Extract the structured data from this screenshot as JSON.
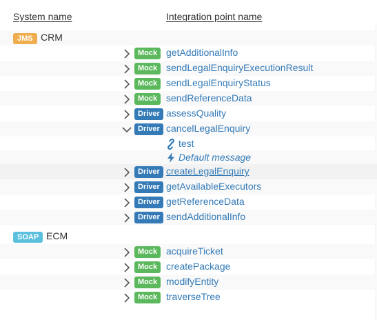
{
  "header": {
    "system_name": "System name",
    "integration_point_name": "Integration point name"
  },
  "systems": [
    {
      "badge": "JMS",
      "badge_color": "#f0ad4e",
      "name": "CRM",
      "points": [
        {
          "type": "Mock",
          "name": "getAdditionalInfo",
          "expanded": false
        },
        {
          "type": "Mock",
          "name": "sendLegalEnquiryExecutionResult",
          "expanded": false
        },
        {
          "type": "Mock",
          "name": "sendLegalEnquiryStatus",
          "expanded": false
        },
        {
          "type": "Mock",
          "name": "sendReferenceData",
          "expanded": false
        },
        {
          "type": "Driver",
          "name": "assessQuality",
          "expanded": false
        },
        {
          "type": "Driver",
          "name": "cancelLegalEnquiry",
          "expanded": true,
          "children": [
            {
              "icon": "link-icon",
              "text": "test",
              "italic": false
            },
            {
              "icon": "lightning-icon",
              "text": "Default message",
              "italic": true
            }
          ]
        },
        {
          "type": "Driver",
          "name": "createLegalEnquiry",
          "expanded": false,
          "hovered": true
        },
        {
          "type": "Driver",
          "name": "getAvailableExecutors",
          "expanded": false
        },
        {
          "type": "Driver",
          "name": "getReferenceData",
          "expanded": false
        },
        {
          "type": "Driver",
          "name": "sendAdditionalInfo",
          "expanded": false
        }
      ]
    },
    {
      "badge": "SOAP",
      "badge_color": "#5bc0de",
      "name": "ECM",
      "points": [
        {
          "type": "Mock",
          "name": "acquireTicket",
          "expanded": false
        },
        {
          "type": "Mock",
          "name": "createPackage",
          "expanded": false
        },
        {
          "type": "Mock",
          "name": "modifyEntity",
          "expanded": false
        },
        {
          "type": "Mock",
          "name": "traverseTree",
          "expanded": false
        }
      ]
    }
  ]
}
